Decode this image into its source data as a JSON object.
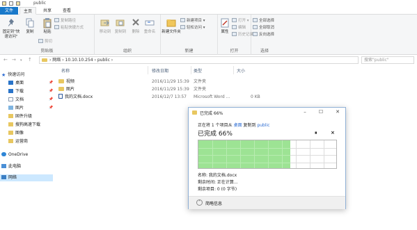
{
  "window": {
    "title": "public"
  },
  "tabs": [
    {
      "label": "文件"
    },
    {
      "label": "主页"
    },
    {
      "label": "共享"
    },
    {
      "label": "查看"
    }
  ],
  "ribbon": {
    "pin_quick_access": "固定到\"快速访问\"",
    "copy": "复制",
    "paste": "粘贴",
    "cut": "剪切",
    "copy_path": "复制路径",
    "paste_shortcut": "粘贴快捷方式",
    "clipboard_group": "剪贴板",
    "move_to": "移动到",
    "copy_to": "复制到",
    "delete": "删除",
    "rename": "重命名",
    "organize_group": "组织",
    "new_folder": "新建文件夹",
    "new_item": "新建项目 ▾",
    "easy_access": "轻松访问 ▾",
    "new_group": "新建",
    "properties": "属性",
    "open": "打开 ▾",
    "edit": "编辑",
    "history": "历史记录",
    "open_group": "打开",
    "select_all": "全部选择",
    "select_none": "全部取消",
    "invert_selection": "反向选择",
    "select_group": "选择"
  },
  "address": {
    "path": "›  网络  ›  10.10.10.254  ›  public  ›",
    "search_placeholder": "搜索\"public\""
  },
  "nav": {
    "quick_access": "快速访问",
    "items": [
      {
        "label": "桌面"
      },
      {
        "label": "下载"
      },
      {
        "label": "文档"
      },
      {
        "label": "图片"
      },
      {
        "label": "固件升级"
      },
      {
        "label": "搜狗高速下载"
      },
      {
        "label": "图像"
      },
      {
        "label": "运营商"
      }
    ],
    "onedrive": "OneDrive",
    "this_pc": "此电脑",
    "network": "网络"
  },
  "files": {
    "columns": {
      "name": "名称",
      "modified": "修改日期",
      "type": "类型",
      "size": "大小"
    },
    "rows": [
      {
        "name": "视频",
        "modified": "2016/11/29 15:39",
        "type": "文件夹",
        "size": ""
      },
      {
        "name": "图片",
        "modified": "2016/11/29 15:39",
        "type": "文件夹",
        "size": ""
      },
      {
        "name": "我的文档.docx",
        "modified": "2016/12/7 13:57",
        "type": "Microsoft Word ...",
        "size": "0 KB"
      }
    ]
  },
  "dialog": {
    "title": "已完成 66%",
    "copying_prefix": "正在将 1 个项目从",
    "source": "桌面",
    "copying_mid": "复制到",
    "destination": "public",
    "percent_label": "已完成 66%",
    "pause_symbol": "⏸",
    "cancel_symbol": "×",
    "name_line": "名称: 我的文档.docx",
    "time_line": "剩余时间: 正在计算...",
    "items_line": "剩余项目: 0 (0 字节)",
    "fewer_details": "简略信息",
    "progress": 0.66,
    "progress_color": "#9de394"
  }
}
